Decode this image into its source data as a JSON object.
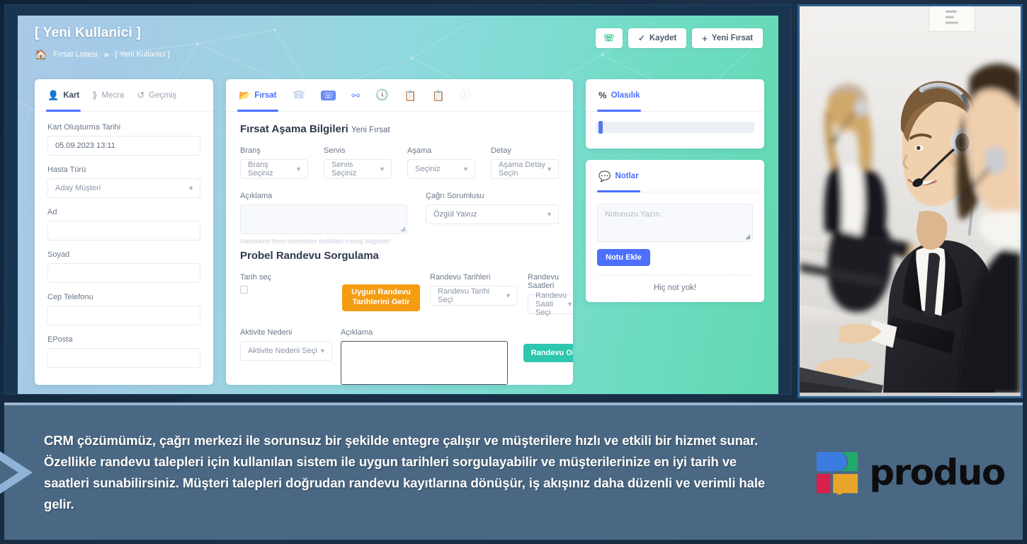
{
  "app": {
    "title": "[ Yeni Kullanici ]",
    "breadcrumb": {
      "home_icon": "home-icon",
      "parent": "Fırsat Listesi",
      "separator": "»",
      "current": "[ Yeni Kullanici ]"
    },
    "header_actions": [
      {
        "icon": "whatsapp-icon",
        "label": ""
      },
      {
        "icon": "check-icon",
        "label": "Kaydet"
      },
      {
        "icon": "plus-icon",
        "label": "Yeni Fırsat"
      }
    ]
  },
  "left_card": {
    "tabs": [
      {
        "label": "Kart",
        "icon": "user-icon",
        "active": true
      },
      {
        "label": "Mecra",
        "icon": "share-icon",
        "active": false
      },
      {
        "label": "Geçmiş",
        "icon": "history-icon",
        "active": false
      }
    ],
    "fields": [
      {
        "label": "Kart Oluşturma Tarihi",
        "type": "text",
        "value": "05.09.2023 13:11"
      },
      {
        "label": "Hasta Türü",
        "type": "select",
        "value": "Aday Müşteri"
      },
      {
        "label": "Ad",
        "type": "text",
        "value": ""
      },
      {
        "label": "Soyad",
        "type": "text",
        "value": ""
      },
      {
        "label": "Cep Telefonu",
        "type": "text",
        "value": ""
      },
      {
        "label": "EPosta",
        "type": "text",
        "value": ""
      }
    ]
  },
  "center_card": {
    "tabs": [
      {
        "label": "Fırsat",
        "icon": "folder-user-icon",
        "active": true
      },
      {
        "label": "",
        "icon": "phone-slash-icon",
        "active": false
      },
      {
        "label": "",
        "icon": "phone-square-icon",
        "active": false
      },
      {
        "label": "",
        "icon": "sitemap-icon",
        "active": false
      },
      {
        "label": "",
        "icon": "clock-icon",
        "active": false
      },
      {
        "label": "",
        "icon": "clipboard-check-icon",
        "active": false
      },
      {
        "label": "",
        "icon": "clipboard-list-icon",
        "active": false
      },
      {
        "label": "",
        "icon": "info-circle-icon",
        "active": false
      }
    ],
    "stage_section": {
      "title": "Fırsat Aşama Bilgileri",
      "subtitle": "Yeni Fırsat",
      "fields": [
        {
          "label": "Branş",
          "placeholder": "Branş Seçiniz"
        },
        {
          "label": "Servis",
          "placeholder": "Servis Seçiniz"
        },
        {
          "label": "Aşama",
          "placeholder": "Seçiniz"
        },
        {
          "label": "Detay",
          "placeholder": "Aşama Detay Seçin"
        }
      ],
      "description_label": "Açıklama",
      "description_value": "",
      "description_hint": "Hastalerin form üzerinden ilettikleri mesaj bilgisidir!",
      "owner_label": "Çağrı Sorumlusu",
      "owner_value": "Özgül Yavuz"
    },
    "appointment_section": {
      "title": "Probel Randevu Sorgulama",
      "date_pick_label": "Tarih seç",
      "date_pick_checked": false,
      "fetch_button": "Uygun Randevu Tarihlerini Getir",
      "dates_label": "Randevu Tarihleri",
      "dates_placeholder": "Randevu Tarihi Seçi",
      "times_label": "Randevu Saatleri",
      "times_placeholder": "Randevu Saati Seçi",
      "activity_label": "Aktivite Nedeni",
      "activity_placeholder": "Aktivite Nedeni Seçi",
      "note_label": "Açıklama",
      "note_value": "",
      "create_button": "Randevu Oluştur"
    }
  },
  "right_column": {
    "probability": {
      "tab_label": "Olasılık",
      "tab_icon": "percent-icon",
      "slider_value": 0
    },
    "notes": {
      "tab_label": "Notlar",
      "tab_icon": "comment-icon",
      "textarea_placeholder": "Notunuzu Yazın.",
      "add_button": "Notu Ekle",
      "empty_text": "Hiç not yok!"
    }
  },
  "caption": {
    "text": "CRM çözümümüz, çağrı merkezi ile sorunsuz bir şekilde entegre çalışır ve müşterilere hızlı ve etkili bir hizmet sunar. Özellikle randevu talepleri için kullanılan sistem ile uygun tarihleri sorgulayabilir ve müşterilerinize en iyi tarih ve saatleri sunabilirsiniz.  Müşteri talepleri doğrudan randevu kayıtlarına dönüşür, iş akışınız daha düzenli ve verimli hale gelir."
  },
  "brand": {
    "name": "produo",
    "logo_colors": {
      "blue": "#3b7ce0",
      "green": "#22a96c",
      "red": "#d7204a",
      "amber": "#e8a52a"
    }
  },
  "photo": {
    "alt": "call-center-agents-with-headsets"
  },
  "theme": {
    "accent_blue": "#4c6fff",
    "accent_teal": "#2dc6ae",
    "accent_orange": "#f59c10",
    "caption_bg": "#4a6884",
    "page_bg": "#16283c"
  }
}
